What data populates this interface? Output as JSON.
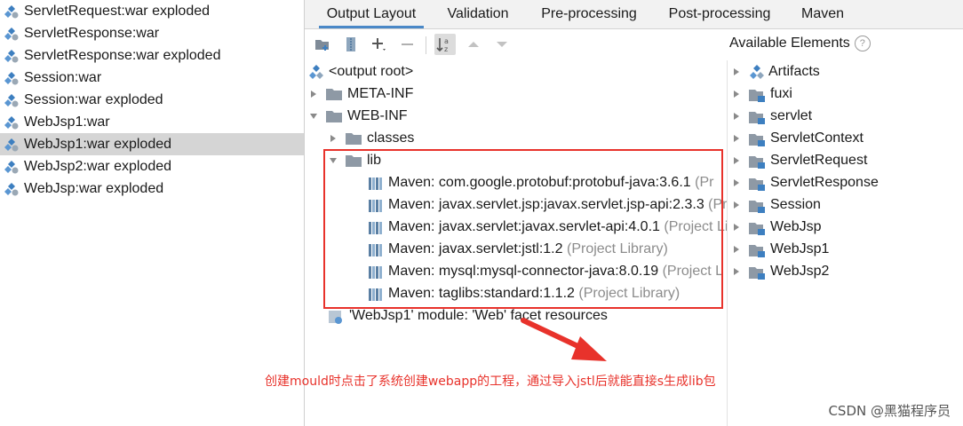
{
  "left_list": {
    "items": [
      {
        "label": "ServletRequest:war exploded",
        "selected": false
      },
      {
        "label": "ServletResponse:war",
        "selected": false
      },
      {
        "label": "ServletResponse:war exploded",
        "selected": false
      },
      {
        "label": "Session:war",
        "selected": false
      },
      {
        "label": "Session:war exploded",
        "selected": false
      },
      {
        "label": "WebJsp1:war",
        "selected": false
      },
      {
        "label": "WebJsp1:war exploded",
        "selected": true
      },
      {
        "label": "WebJsp2:war exploded",
        "selected": false
      },
      {
        "label": "WebJsp:war exploded",
        "selected": false
      }
    ]
  },
  "tabs": [
    "Output Layout",
    "Validation",
    "Pre-processing",
    "Post-processing",
    "Maven"
  ],
  "active_tab": "Output Layout",
  "output_tree": {
    "root": "<output root>",
    "meta_inf": "META-INF",
    "web_inf": "WEB-INF",
    "classes": "classes",
    "lib": "lib",
    "libraries": [
      {
        "name": "Maven: com.google.protobuf:protobuf-java:3.6.1",
        "suffix": "(Pr"
      },
      {
        "name": "Maven: javax.servlet.jsp:javax.servlet.jsp-api:2.3.3",
        "suffix": "(Pr"
      },
      {
        "name": "Maven: javax.servlet:javax.servlet-api:4.0.1",
        "suffix": "(Project Li"
      },
      {
        "name": "Maven: javax.servlet:jstl:1.2",
        "suffix": "(Project Library)"
      },
      {
        "name": "Maven: mysql:mysql-connector-java:8.0.19",
        "suffix": "(Project L"
      },
      {
        "name": "Maven: taglibs:standard:1.1.2",
        "suffix": "(Project Library)"
      }
    ],
    "facet": "'WebJsp1' module: 'Web' facet resources"
  },
  "available": {
    "heading": "Available Elements",
    "help": "?",
    "items": [
      "Artifacts",
      "fuxi",
      "servlet",
      "ServletContext",
      "ServletRequest",
      "ServletResponse",
      "Session",
      "WebJsp",
      "WebJsp1",
      "WebJsp2"
    ]
  },
  "annotation": "创建mould时点击了系统创建webapp的工程，通过导入jstl后就能直接s生成lib包",
  "watermark": "CSDN @黑猫程序员",
  "colors": {
    "accent": "#4a88c7",
    "red_annotation": "#e8322b",
    "selection": "#d5d5d5"
  }
}
